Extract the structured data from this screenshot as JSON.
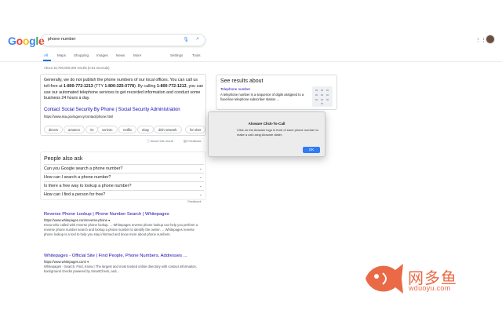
{
  "header": {
    "logo": "Google",
    "search_value": "phone number",
    "icons": [
      "mic-icon",
      "search-icon",
      "apps-grid-icon"
    ]
  },
  "tabs": [
    {
      "label": "All",
      "active": true
    },
    {
      "label": "Maps"
    },
    {
      "label": "Shopping"
    },
    {
      "label": "Images"
    },
    {
      "label": "News"
    },
    {
      "label": "More"
    },
    {
      "label": "Settings"
    },
    {
      "label": "Tools"
    }
  ],
  "stats": "About 15,790,000,000 results (0.51 seconds)",
  "snippet": {
    "text_1": "Generally, we do not publish the phone numbers of our local offices. You can call us toll-free at ",
    "phone_1": "1-800-772-1213",
    "text_2": " (TTY ",
    "phone_tty": "1-800-325-0778",
    "text_3": "). By calling ",
    "phone_2": "1-800-772-1213",
    "text_4": ", you can use our automated telephone services to get recorded information and conduct some business 24 hours a day.",
    "link": "Contact Social Security By Phone | Social Security Administration",
    "url": "https://www.ssa.gov/agency/contact/phone.html",
    "chips": [
      "directv",
      "amazon",
      "irs",
      "verizon",
      "netflix",
      "ebay",
      "dish network",
      "for ober"
    ],
    "about": "About this result",
    "feedback": "Feedback"
  },
  "paa": {
    "title": "People also ask",
    "questions": [
      "Can you Google search a phone number?",
      "How can I search a phone number?",
      "Is there a free way to lookup a phone number?",
      "How can I find a person for free?"
    ],
    "feedback": "Feedback"
  },
  "results": [
    {
      "title": "Reverse Phone Lookup | Phone Number Search | Whitepages",
      "url": "https://www.whitepages.com/reverse-phone ▾",
      "desc": "Know who called with reverse phone lookup. ... Whitepages reverse phone lookup can help you perform a reverse phone number search and lookup a phone number to identify the owner. ... Whitepages reverse phone lookup is a tool to help you stay informed and know more about phone numbers."
    },
    {
      "title": "Whitepages - Official Site | Find People, Phone Numbers, Addresses ...",
      "url": "https://www.whitepages.com/ ▾",
      "desc": "Whitepages - Search, Find, Know | The largest and most trusted online directory with contact information, background checks powered by SmartCheck, and..."
    }
  ],
  "knowledge_panel": {
    "title": "See results about",
    "link": "Telephone number",
    "desc": "A telephone number is a sequence of digits assigned to a fixed-line telephone subscriber station ..."
  },
  "modal": {
    "title": "Aloware Click-To-Call",
    "body": "Click on the Aloware logo in front of each phone number to make a call using Aloware dialer.",
    "ok": "OK"
  },
  "watermark": {
    "cn": "网多鱼",
    "url": "wduoyu.com"
  },
  "colors": {
    "link": "#1a0dab",
    "accent": "#1a73e8",
    "modal_button": "#2f7cf6",
    "watermark": "#ea6a47"
  }
}
